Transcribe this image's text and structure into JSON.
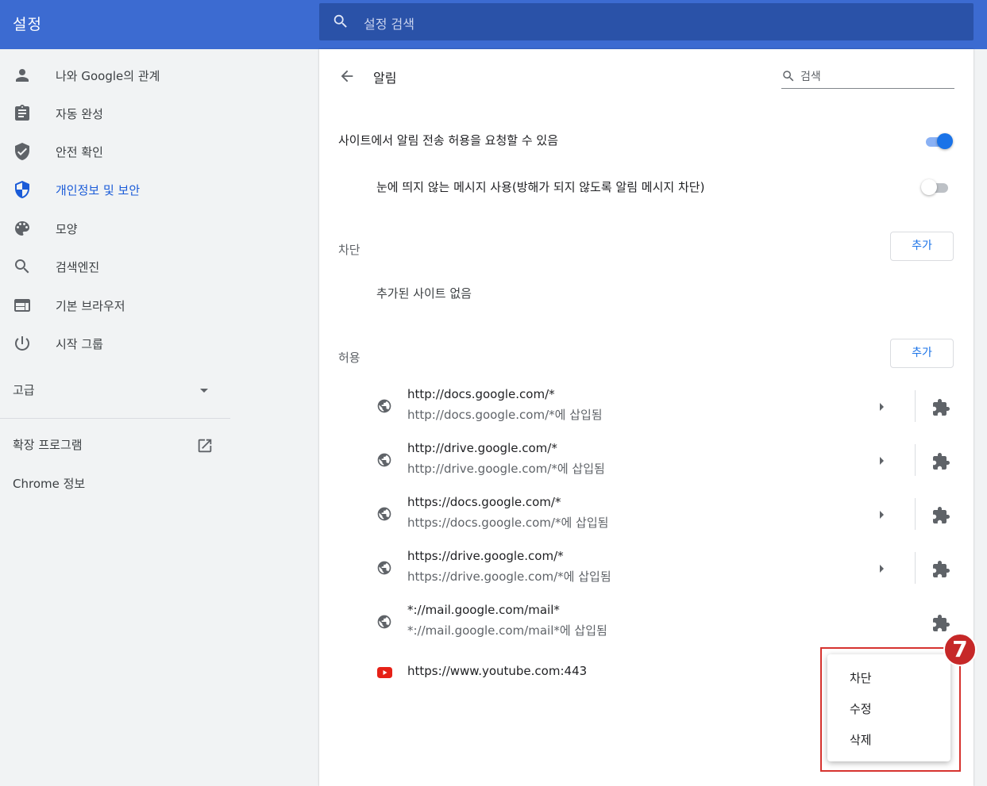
{
  "header": {
    "title": "설정",
    "search_placeholder": "설정 검색"
  },
  "sidebar": {
    "items": [
      {
        "label": "나와 Google의 관계",
        "icon": "person-icon"
      },
      {
        "label": "자동 완성",
        "icon": "clipboard-icon"
      },
      {
        "label": "안전 확인",
        "icon": "shield-check-icon"
      },
      {
        "label": "개인정보 및 보안",
        "icon": "shield-icon",
        "active": true
      },
      {
        "label": "모양",
        "icon": "palette-icon"
      },
      {
        "label": "검색엔진",
        "icon": "search-icon"
      },
      {
        "label": "기본 브라우저",
        "icon": "browser-icon"
      },
      {
        "label": "시작 그룹",
        "icon": "power-icon"
      }
    ],
    "advanced": "고급",
    "extensions": "확장 프로그램",
    "about": "Chrome 정보"
  },
  "page": {
    "title": "알림",
    "search_placeholder": "검색",
    "ask_setting": {
      "label": "사이트에서 알림 전송 허용을 요청할 수 있음",
      "enabled": true
    },
    "quiet_setting": {
      "label": "눈에 띄지 않는 메시지 사용(방해가 되지 않도록 알림 메시지 차단)",
      "enabled": false
    },
    "block": {
      "label": "차단",
      "add_label": "추가",
      "empty": "추가된 사이트 없음"
    },
    "allow": {
      "label": "허용",
      "add_label": "추가"
    },
    "sites": [
      {
        "url": "http://docs.google.com/*",
        "sub": "http://docs.google.com/*에 삽입됨"
      },
      {
        "url": "http://drive.google.com/*",
        "sub": "http://drive.google.com/*에 삽입됨"
      },
      {
        "url": "https://docs.google.com/*",
        "sub": "https://docs.google.com/*에 삽입됨"
      },
      {
        "url": "https://drive.google.com/*",
        "sub": "https://drive.google.com/*에 삽입됨"
      },
      {
        "url": "*://mail.google.com/mail*",
        "sub": "*://mail.google.com/mail*에 삽입됨"
      }
    ],
    "youtube_site": {
      "url": "https://www.youtube.com:443"
    }
  },
  "context_menu": {
    "items": [
      "차단",
      "수정",
      "삭제"
    ],
    "callout_number": "7"
  },
  "colors": {
    "header_bg": "#3c6bd1",
    "accent": "#1a73e8",
    "callout": "#c62828"
  }
}
